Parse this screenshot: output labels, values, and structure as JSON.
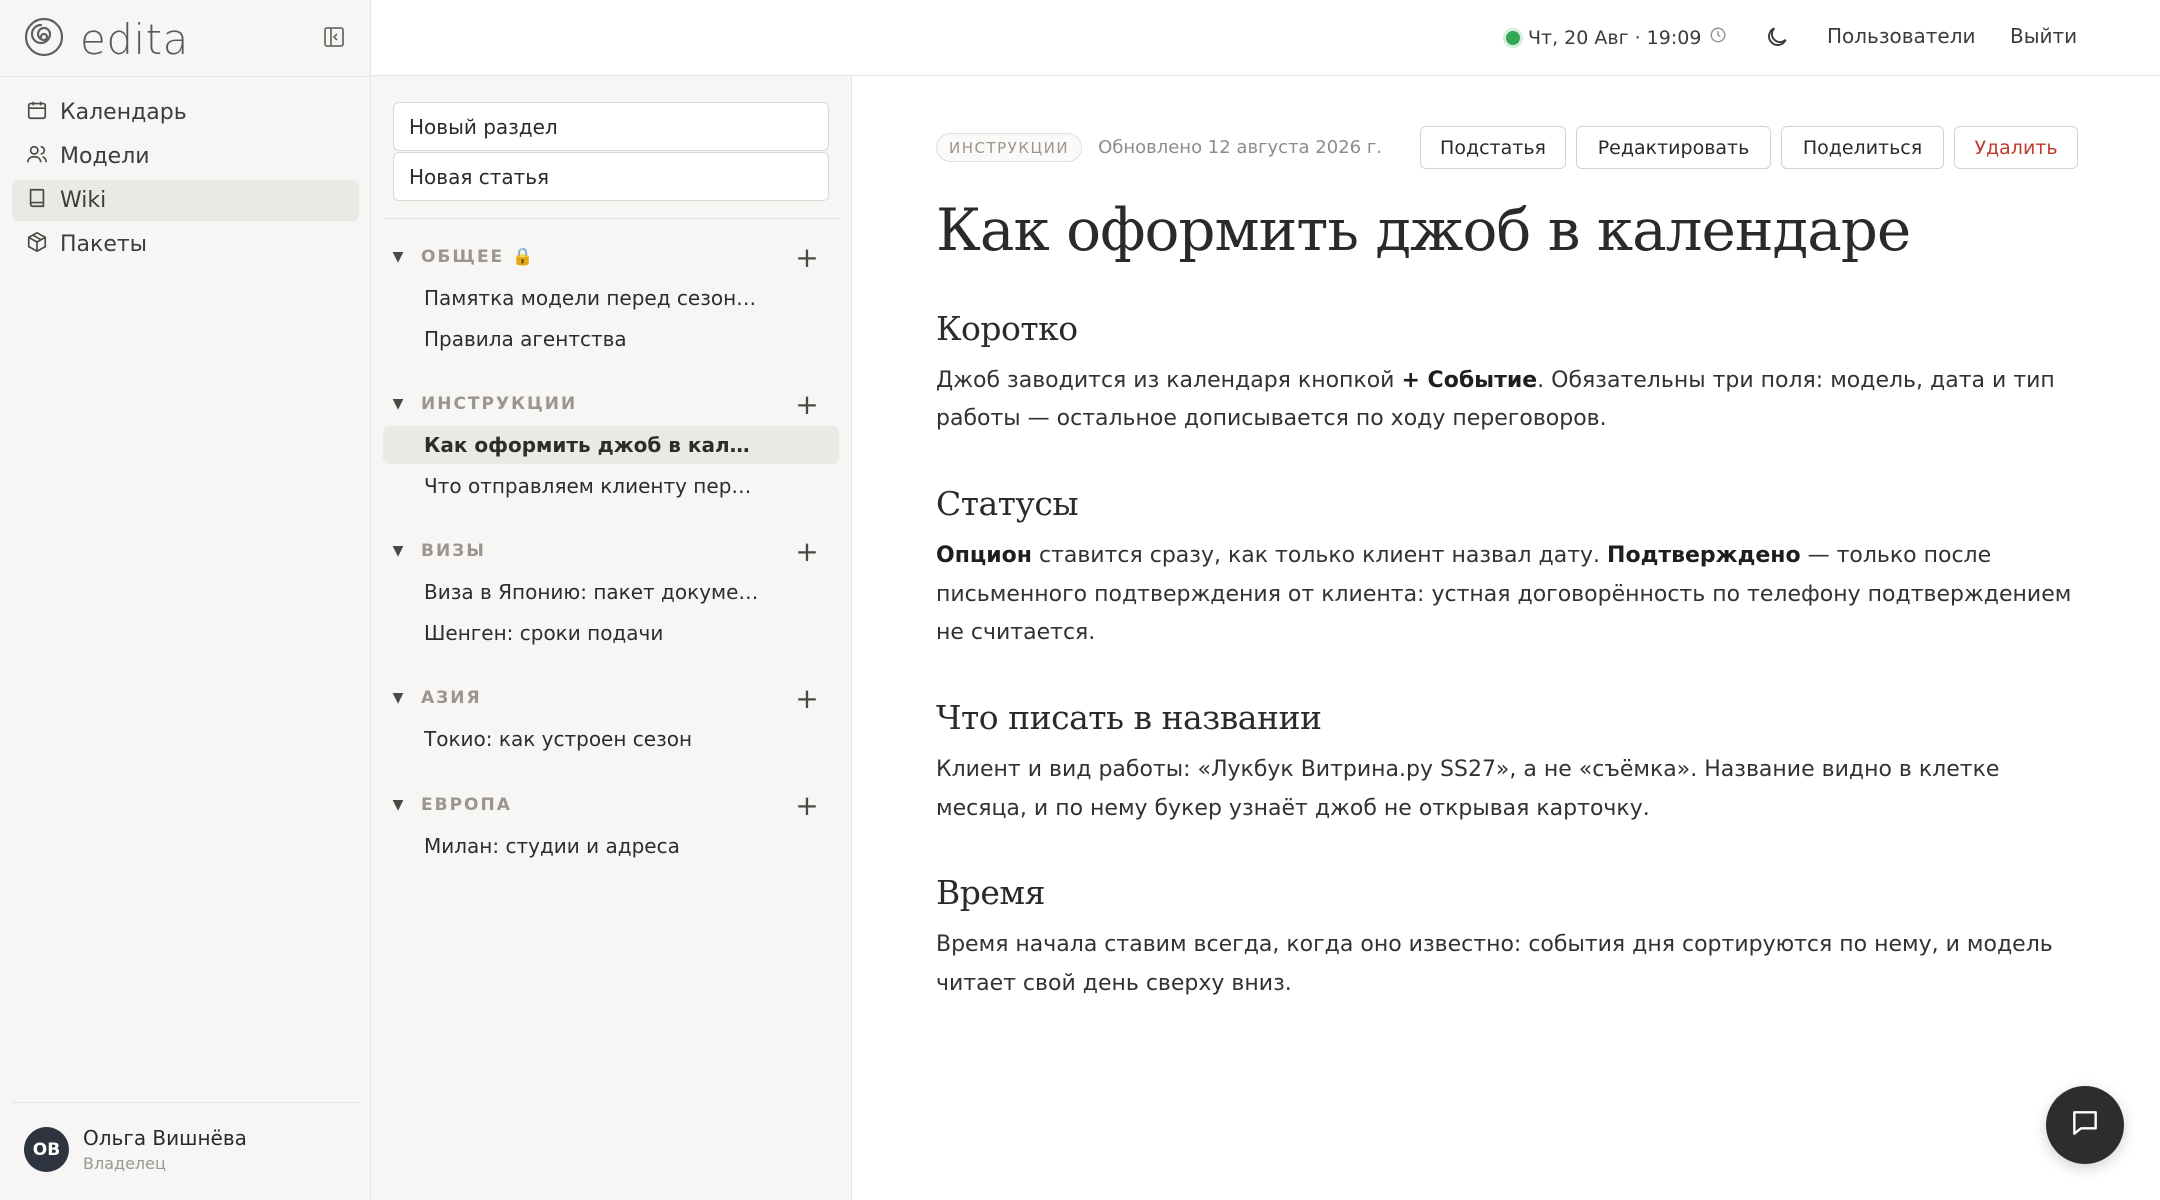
{
  "app": {
    "brand": "edita"
  },
  "sidebar": {
    "items": [
      {
        "label": "Календарь",
        "icon": "calendar-icon"
      },
      {
        "label": "Модели",
        "icon": "users-icon"
      },
      {
        "label": "Wiki",
        "icon": "book-icon",
        "active": true
      },
      {
        "label": "Пакеты",
        "icon": "package-icon"
      }
    ],
    "user": {
      "initials": "ОВ",
      "name": "Ольга Вишнёва",
      "role": "Владелец"
    }
  },
  "topbar": {
    "datetime": "Чт, 20 Авг · 19:09",
    "users_link": "Пользователи",
    "logout_link": "Выйти",
    "status_color": "#34a853"
  },
  "middle": {
    "new_section": "Новый раздел",
    "new_article": "Новая статья",
    "sections": [
      {
        "title": "ОБЩЕЕ 🔒",
        "articles": [
          "Памятка модели перед сезон…",
          "Правила агентства"
        ]
      },
      {
        "title": "ИНСТРУКЦИИ",
        "articles": [
          "Как оформить джоб в кал…",
          "Что отправляем клиенту пер…"
        ]
      },
      {
        "title": "ВИЗЫ",
        "articles": [
          "Виза в Японию: пакет докуме…",
          "Шенген: сроки подачи"
        ]
      },
      {
        "title": "АЗИЯ",
        "articles": [
          "Токио: как устроен сезон"
        ]
      },
      {
        "title": "ЕВРОПА",
        "articles": [
          "Милан: студии и адреса"
        ]
      }
    ],
    "active_article": "Как оформить джоб в кал…"
  },
  "article": {
    "tag": "ИНСТРУКЦИИ",
    "updated": "Обновлено 12 августа 2026 г.",
    "buttons": {
      "subarticle": "Подстатья",
      "edit": "Редактировать",
      "share": "Поделиться",
      "delete": "Удалить"
    },
    "title": "Как оформить джоб в календаре",
    "sections": [
      {
        "heading": "Коротко",
        "p1": "Джоб заводится из календаря кнопкой ",
        "b1": "+ Событие",
        "p2": ". Обязательны три поля: модель, дата и тип работы — остальное дописывается по ходу переговоров."
      },
      {
        "heading": "Статусы",
        "b1": "Опцион",
        "p1": " ставится сразу, как только клиент назвал дату. ",
        "b2": "Подтверждено",
        "p2": " — только после письменного подтверждения от клиента: устная договорённость по телефону подтверждением не считается."
      },
      {
        "heading": "Что писать в названии",
        "p1": "Клиент и вид работы: «Лукбук Витрина.ру SS27», а не «съёмка». Название видно в клетке месяца, и по нему букер узнаёт джоб не открывая карточку."
      },
      {
        "heading": "Время",
        "p1": "Время начала ставим всегда, когда оно известно: события дня сортируются по нему, и модель читает свой день сверху вниз."
      }
    ]
  }
}
